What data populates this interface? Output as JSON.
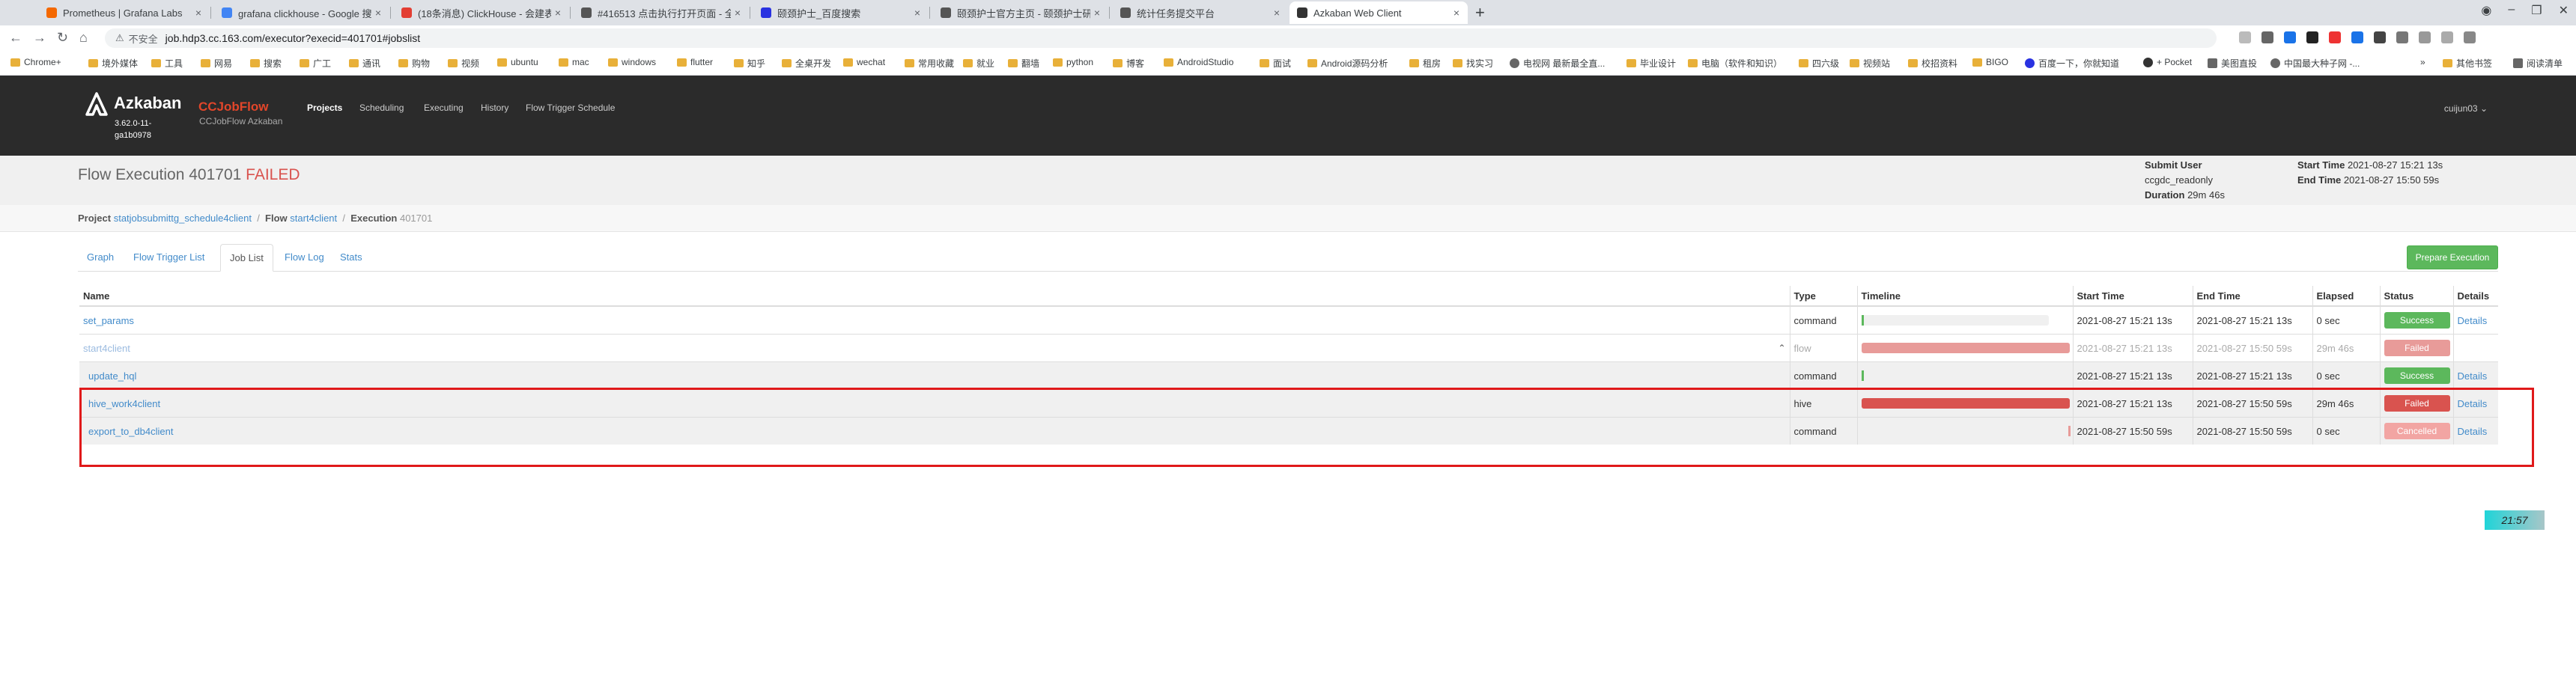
{
  "browser": {
    "tabs": [
      {
        "title": "Prometheus | Grafana Labs",
        "color": "#f46800"
      },
      {
        "title": "grafana clickhouse - Google 搜",
        "color": "#4285f4"
      },
      {
        "title": "(18条消息) ClickHouse - 会建表",
        "color": "#e33e33"
      },
      {
        "title": "#416513 点击执行打开页面 - 全",
        "color": "#555555"
      },
      {
        "title": "颐颈护士_百度搜索",
        "color": "#2932e1"
      },
      {
        "title": "颐颈护士官方主页 - 颐颈护士研",
        "color": "#555555"
      },
      {
        "title": "统计任务提交平台",
        "color": "#555555"
      },
      {
        "title": "Azkaban Web Client",
        "color": "#333333"
      }
    ],
    "new_tab": "+",
    "omnibox": {
      "insecure_label": "不安全",
      "url": "job.hdp3.cc.163.com/executor?execid=401701#jobslist"
    },
    "bookmarks": [
      "Chrome+",
      "境外媒体",
      "工具",
      "网易",
      "搜索",
      "广工",
      "通讯",
      "购物",
      "视频",
      "ubuntu",
      "mac",
      "windows",
      "flutter",
      "知乎",
      "全桌开发",
      "wechat",
      "常用收藏",
      "就业",
      "翻墙",
      "python",
      "博客",
      "AndroidStudio",
      "面试",
      "Android源码分析",
      "租房",
      "找实习",
      "电视网 最新最全直...",
      "毕业设计",
      "电脑（软件和知识）",
      "四六级",
      "视频站",
      "校招资料",
      "BIGO",
      "百度一下，你就知道",
      "+ Pocket",
      "美图直投",
      "中国最大种子网 -...",
      "»",
      "其他书签",
      "阅读清单"
    ]
  },
  "header": {
    "brand": "Azkaban",
    "version": "3.62.0-11-ga1b0978",
    "app_name": "CCJobFlow",
    "app_sub": "CCJobFlow Azkaban",
    "nav": [
      "Projects",
      "Scheduling",
      "Executing",
      "History",
      "Flow Trigger Schedule"
    ],
    "user": "cuijun03 ⌄"
  },
  "execution": {
    "title_prefix": "Flow Execution 401701",
    "status": "FAILED",
    "submit_user_label": "Submit User",
    "submit_user": "ccgdc_readonly",
    "duration_label": "Duration",
    "duration": "29m 46s",
    "start_time_label": "Start Time",
    "start_time": "2021-08-27 15:21 13s",
    "end_time_label": "End Time",
    "end_time": "2021-08-27 15:50 59s"
  },
  "breadcrumb": {
    "project_label": "Project",
    "project": "statjobsubmittg_schedule4client",
    "flow_label": "Flow",
    "flow": "start4client",
    "execution_label": "Execution",
    "execution": "401701"
  },
  "subtabs": [
    "Graph",
    "Flow Trigger List",
    "Job List",
    "Flow Log",
    "Stats"
  ],
  "prepare_button": "Prepare Execution",
  "table": {
    "headers": [
      "Name",
      "Type",
      "Timeline",
      "Start Time",
      "End Time",
      "Elapsed",
      "Status",
      "Details"
    ],
    "rows": [
      {
        "name": "set_params",
        "type": "command",
        "timeline": 0.0,
        "start": "2021-08-27 15:21 13s",
        "end": "2021-08-27 15:21 13s",
        "elapsed": "0 sec",
        "status": "Success",
        "details": "Details"
      },
      {
        "name": "start4client",
        "type": "flow",
        "timeline": 1.0,
        "start": "2021-08-27 15:21 13s",
        "end": "2021-08-27 15:50 59s",
        "elapsed": "29m 46s",
        "status": "Failed",
        "details": ""
      },
      {
        "name": "update_hql",
        "type": "command",
        "timeline": 0.0,
        "start": "2021-08-27 15:21 13s",
        "end": "2021-08-27 15:21 13s",
        "elapsed": "0 sec",
        "status": "Success",
        "details": "Details"
      },
      {
        "name": "hive_work4client",
        "type": "hive",
        "timeline": 1.0,
        "start": "2021-08-27 15:21 13s",
        "end": "2021-08-27 15:50 59s",
        "elapsed": "29m 46s",
        "status": "Failed",
        "details": "Details"
      },
      {
        "name": "export_to_db4client",
        "type": "command",
        "timeline": 0.0,
        "start": "2021-08-27 15:50 59s",
        "end": "2021-08-27 15:50 59s",
        "elapsed": "0 sec",
        "status": "Cancelled",
        "details": "Details"
      }
    ]
  },
  "clock": "21:57",
  "colors": {
    "success": "#5cb85c",
    "failed": "#d9534f",
    "cancelled": "#f2a5a3",
    "highlight": "#e0191a"
  }
}
